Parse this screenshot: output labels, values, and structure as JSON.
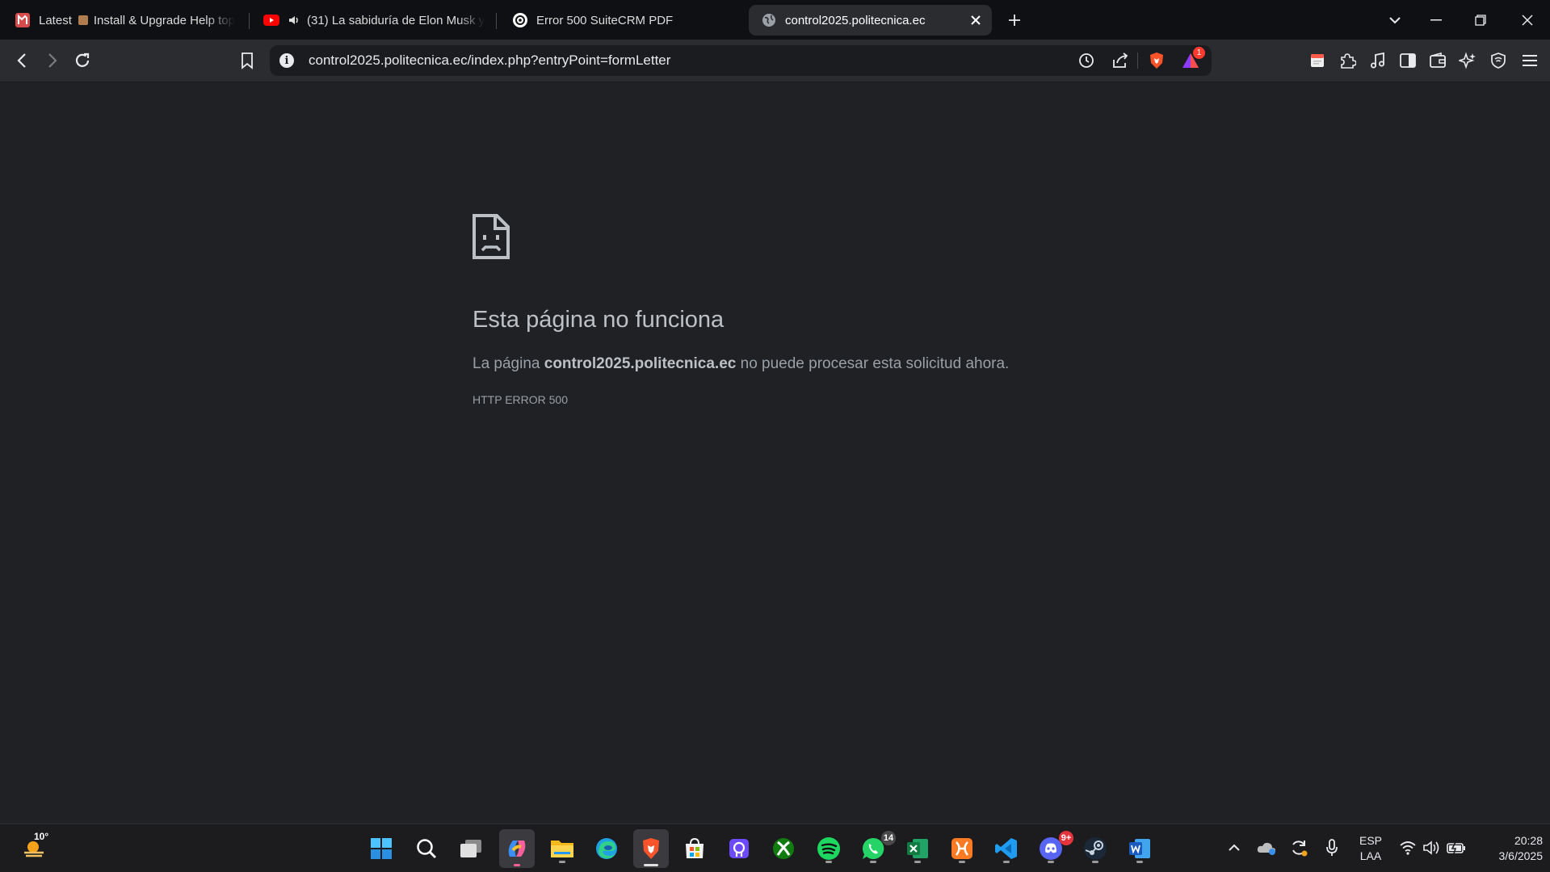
{
  "tabs": [
    {
      "label": "Latest",
      "extra": "Install & Upgrade Help top"
    },
    {
      "label": "(31) La sabiduría de Elon Musk y"
    },
    {
      "label": "Error 500 SuiteCRM PDF"
    },
    {
      "label": "control2025.politecnica.ec",
      "active": true
    }
  ],
  "toolbar": {
    "url": "control2025.politecnica.ec/index.php?entryPoint=formLetter",
    "rewards_badge": "1"
  },
  "error": {
    "title": "Esta página no funciona",
    "message_prefix": "La página",
    "host": "control2025.politecnica.ec",
    "message_suffix": "no puede procesar esta solicitud ahora.",
    "code": "HTTP ERROR 500"
  },
  "taskbar": {
    "weather_temp": "10°",
    "whatsapp_badge": "14",
    "discord_badge": "9+",
    "language": "ESP",
    "layout": "LAA",
    "time": "20:28",
    "date": "3/6/2025"
  },
  "colors": {
    "background": "#202124",
    "tabstrip": "#0f1013",
    "toolbar": "#2b2c30",
    "brave_orange": "#fb542b"
  }
}
